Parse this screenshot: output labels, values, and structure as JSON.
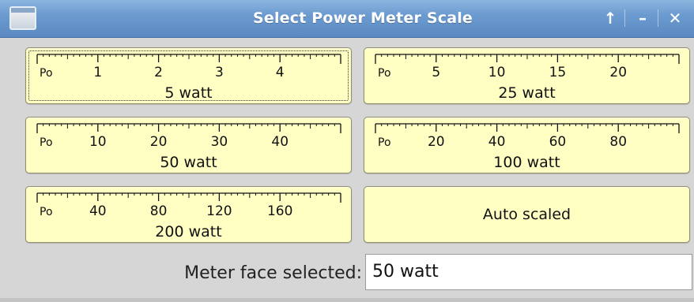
{
  "window": {
    "title": "Select Power Meter Scale",
    "controls": {
      "shade_icon": "↑",
      "minimize_icon": "–",
      "close_icon": "✕"
    }
  },
  "meters": [
    {
      "id": "5w",
      "label": "5 watt",
      "zero_label": "Po",
      "focused": true,
      "max": 5,
      "tick_step": 0.1,
      "mid_step": 0.5,
      "major_step": 1,
      "labels": [
        "1",
        "2",
        "3",
        "4"
      ],
      "label_values": [
        1,
        2,
        3,
        4
      ]
    },
    {
      "id": "25w",
      "label": "25 watt",
      "zero_label": "Po",
      "focused": false,
      "max": 25,
      "tick_step": 0.5,
      "mid_step": 2.5,
      "major_step": 5,
      "labels": [
        "5",
        "10",
        "15",
        "20"
      ],
      "label_values": [
        5,
        10,
        15,
        20
      ]
    },
    {
      "id": "50w",
      "label": "50 watt",
      "zero_label": "Po",
      "focused": false,
      "max": 50,
      "tick_step": 1,
      "mid_step": 5,
      "major_step": 10,
      "labels": [
        "10",
        "20",
        "30",
        "40"
      ],
      "label_values": [
        10,
        20,
        30,
        40
      ]
    },
    {
      "id": "100w",
      "label": "100 watt",
      "zero_label": "Po",
      "focused": false,
      "max": 100,
      "tick_step": 2,
      "mid_step": 10,
      "major_step": 20,
      "labels": [
        "20",
        "40",
        "60",
        "80"
      ],
      "label_values": [
        20,
        40,
        60,
        80
      ]
    },
    {
      "id": "200w",
      "label": "200 watt",
      "zero_label": "Po",
      "focused": false,
      "max": 200,
      "tick_step": 4,
      "mid_step": 20,
      "major_step": 40,
      "labels": [
        "40",
        "80",
        "120",
        "160"
      ],
      "label_values": [
        40,
        80,
        120,
        160
      ]
    }
  ],
  "auto_button": {
    "label": "Auto scaled"
  },
  "status": {
    "label": "Meter face selected:",
    "value": "50 watt"
  },
  "colors": {
    "titlebar": "#6c9bd0",
    "button_face": "#ffffc4",
    "window_bg": "#d6d6d6"
  }
}
